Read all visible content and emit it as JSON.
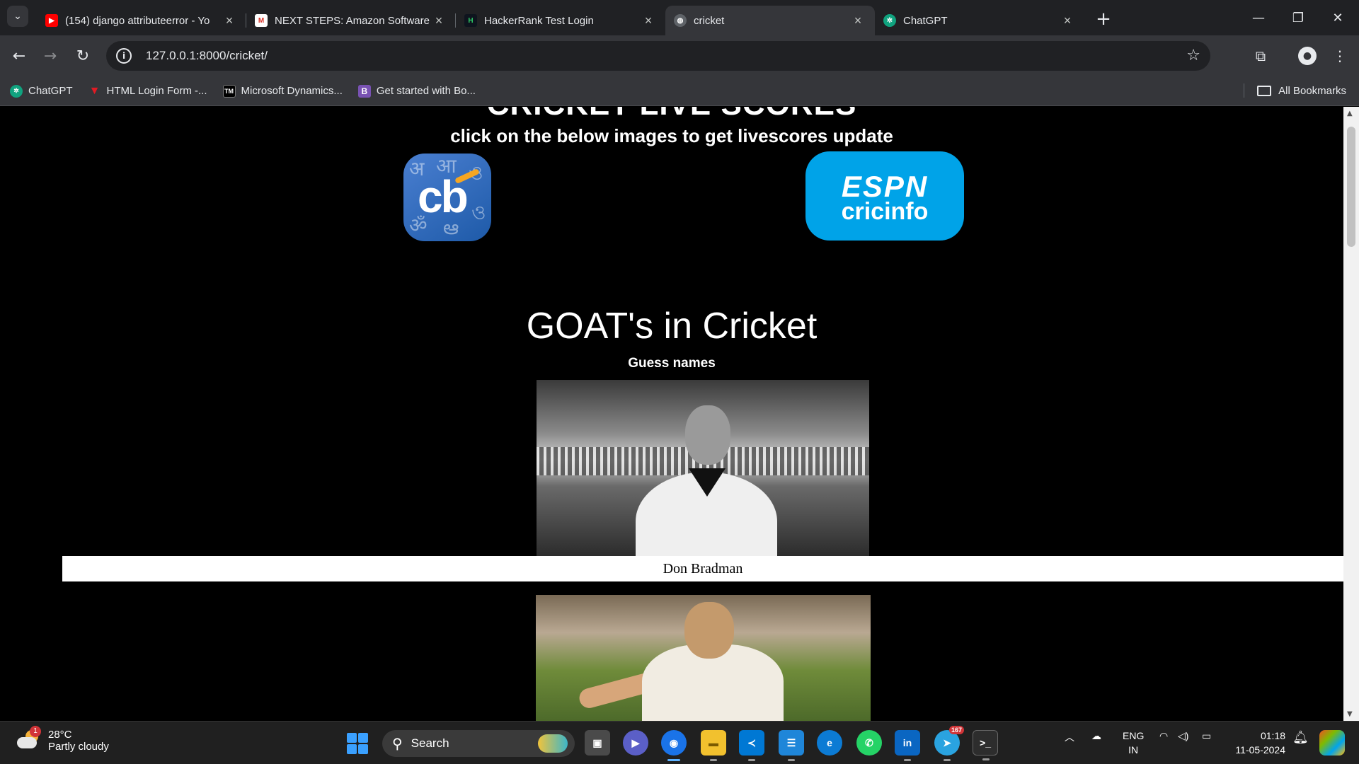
{
  "browser": {
    "tabs": [
      {
        "title": "(154) django attributeerror - Yo",
        "favicon": "youtube-icon",
        "active": false
      },
      {
        "title": "NEXT STEPS: Amazon Software",
        "favicon": "gmail-icon",
        "active": false
      },
      {
        "title": "HackerRank Test Login",
        "favicon": "hackerrank-icon",
        "active": false
      },
      {
        "title": "cricket",
        "favicon": "globe-icon",
        "active": true
      },
      {
        "title": "ChatGPT",
        "favicon": "chatgpt-icon",
        "active": false
      }
    ],
    "url": "127.0.0.1:8000/cricket/",
    "bookmarks": [
      {
        "label": "ChatGPT",
        "icon": "chatgpt-icon"
      },
      {
        "label": "HTML Login Form -...",
        "icon": "red-v-icon"
      },
      {
        "label": "Microsoft Dynamics...",
        "icon": "tm-icon"
      },
      {
        "label": "Get started with Bo...",
        "icon": "bootstrap-icon"
      }
    ],
    "all_bookmarks": "All Bookmarks"
  },
  "page": {
    "heading_cut": "CRICKET LIVE SCORES",
    "subheading": "click on the below images to get livescores update",
    "logos": {
      "cricbuzz": "cb",
      "espn": "ESPN",
      "cricinfo": "cricinfo"
    },
    "goat_title": "GOAT's in Cricket",
    "guess_label": "Guess names",
    "players": [
      {
        "caption": "Don Bradman"
      }
    ]
  },
  "taskbar": {
    "weather_badge": "1",
    "temperature": "28°C",
    "condition": "Partly cloudy",
    "search_label": "Search",
    "telegram_badge": "167",
    "lang_line1": "ENG",
    "lang_line2": "IN",
    "time": "01:18",
    "date": "11-05-2024"
  }
}
